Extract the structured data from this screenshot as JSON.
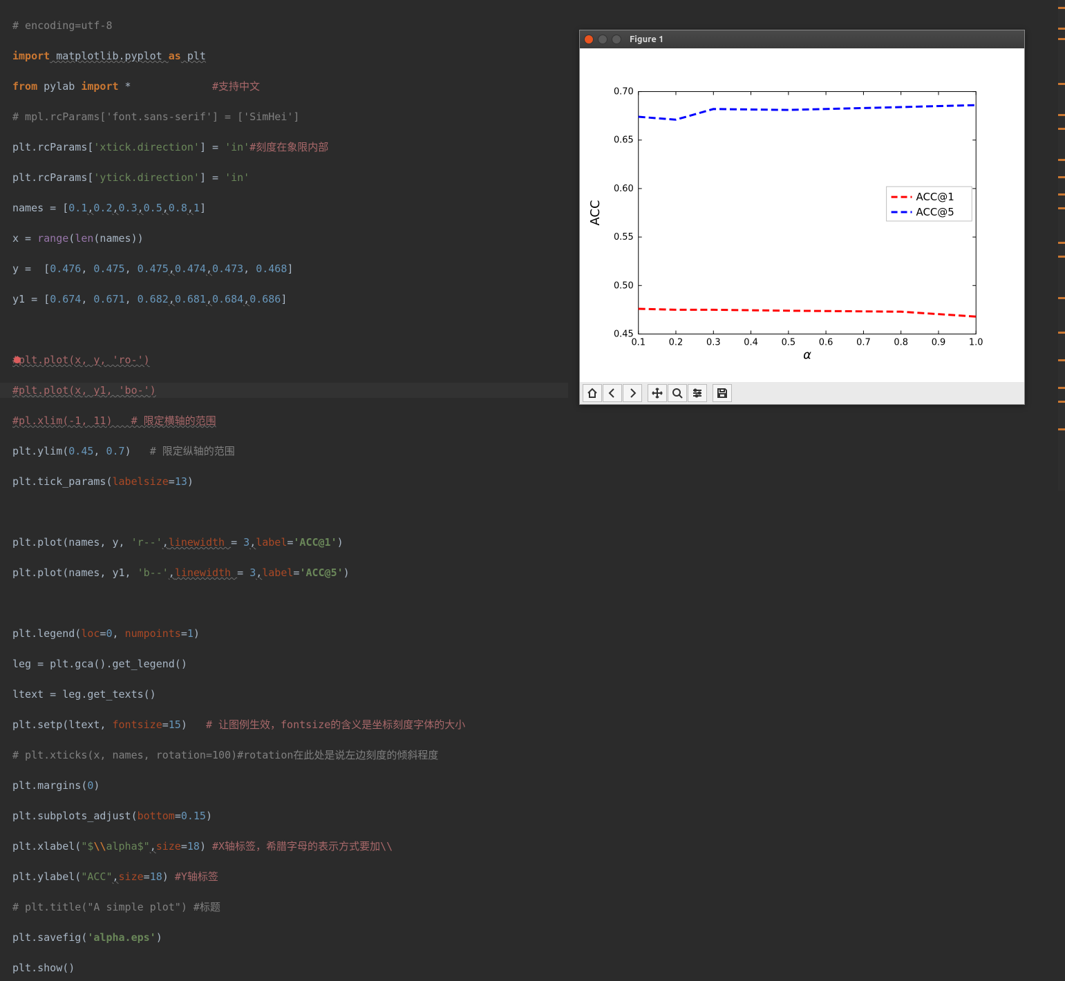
{
  "chart_data": {
    "type": "line",
    "x": [
      0.1,
      0.2,
      0.3,
      0.5,
      0.8,
      1.0
    ],
    "series": [
      {
        "name": "ACC@1",
        "values": [
          0.476,
          0.475,
          0.475,
          0.474,
          0.473,
          0.468
        ],
        "color": "#ff0000",
        "style": "dashed"
      },
      {
        "name": "ACC@5",
        "values": [
          0.674,
          0.671,
          0.682,
          0.681,
          0.684,
          0.686
        ],
        "color": "#0000ff",
        "style": "dashed"
      }
    ],
    "xlabel": "α",
    "ylabel": "ACC",
    "xlim": [
      0.1,
      1.0
    ],
    "ylim": [
      0.45,
      0.7
    ],
    "xticks": [
      0.1,
      0.2,
      0.3,
      0.4,
      0.5,
      0.6,
      0.7,
      0.8,
      0.9,
      1.0
    ],
    "yticks": [
      0.45,
      0.5,
      0.55,
      0.6,
      0.65,
      0.7
    ],
    "legend_position": "right"
  },
  "figure": {
    "title": "Figure 1"
  },
  "legend": {
    "item1": "ACC@1",
    "item2": "ACC@5"
  },
  "axis": {
    "xlabel": "α",
    "ylabel": "ACC"
  },
  "yt": {
    "t0": "0.45",
    "t1": "0.50",
    "t2": "0.55",
    "t3": "0.60",
    "t4": "0.65",
    "t5": "0.70"
  },
  "xt": {
    "t0": "0.1",
    "t1": "0.2",
    "t2": "0.3",
    "t3": "0.4",
    "t4": "0.5",
    "t5": "0.6",
    "t6": "0.7",
    "t7": "0.8",
    "t8": "0.9",
    "t9": "1.0"
  },
  "code": {
    "l1": "# encoding=utf-8",
    "l2a": "import",
    "l2b": " matplotlib.pyplot ",
    "l2c": "as",
    "l2d": " plt",
    "l3a": "from",
    "l3b": " pylab ",
    "l3c": "import",
    "l3d": " *",
    "l3e": "#支持中文",
    "l4": "# mpl.rcParams['font.sans-serif'] = ['SimHei']",
    "l5a": "plt.rcParams[",
    "l5b": "'xtick.direction'",
    "l5c": "] = ",
    "l5d": "'in'",
    "l5e": "#刻度在象限内部",
    "l6a": "plt.rcParams[",
    "l6b": "'ytick.direction'",
    "l6c": "] = ",
    "l6d": "'in'",
    "l7a": "names = [",
    "l7b": "0.1",
    "l7c": ",",
    "l7d": "0.2",
    "l7e": ",",
    "l7f": "0.3",
    "l7g": ",",
    "l7h": "0.5",
    "l7i": ",",
    "l7j": "0.8",
    "l7k": ",",
    "l7l": "1",
    "l7m": "]",
    "l8a": "x = ",
    "l8b": "range",
    "l8c": "(",
    "l8d": "len",
    "l8e": "(names))",
    "l9a": "y =  [",
    "l9b": "0.476",
    "l9c": ", ",
    "l9d": "0.475",
    "l9e": ", ",
    "l9f": "0.475",
    "l9g": ",",
    "l9h": "0.474",
    "l9i": ",",
    "l9j": "0.473",
    "l9k": ", ",
    "l9l": "0.468",
    "l9m": "]",
    "l10a": "y1 = [",
    "l10b": "0.674",
    "l10c": ", ",
    "l10d": "0.671",
    "l10e": ", ",
    "l10f": "0.682",
    "l10g": ",",
    "l10h": "0.681",
    "l10i": ",",
    "l10j": "0.684",
    "l10k": ",",
    "l10l": "0.686",
    "l10m": "]",
    "l12": "#plt.plot(x, y, 'ro-')",
    "l13": "#plt.plot(x, y1, 'bo-')",
    "l14": "#pl.xlim(-1, 11)   # 限定横轴的范围",
    "l15a": "plt.ylim(",
    "l15b": "0.45",
    "l15c": ", ",
    "l15d": "0.7",
    "l15e": ")   ",
    "l15f": "# 限定纵轴的范围",
    "l16a": "plt.tick_params(",
    "l16b": "labelsize",
    "l16c": "=",
    "l16d": "13",
    "l16e": ")",
    "l18a": "plt.plot(names, y, ",
    "l18b": "'r--'",
    "l18c": ",",
    "l18d": "linewidth ",
    "l18e": "= ",
    "l18f": "3",
    "l18g": ",",
    "l18h": "label",
    "l18i": "=",
    "l18j": "'ACC@1'",
    "l18k": ")",
    "l19a": "plt.plot(names, y1, ",
    "l19b": "'b--'",
    "l19c": ",",
    "l19d": "linewidth ",
    "l19e": "= ",
    "l19f": "3",
    "l19g": ",",
    "l19h": "label",
    "l19i": "=",
    "l19j": "'ACC@5'",
    "l19k": ")",
    "l21a": "plt.legend(",
    "l21b": "loc",
    "l21c": "=",
    "l21d": "0",
    "l21e": ", ",
    "l21f": "numpoints",
    "l21g": "=",
    "l21h": "1",
    "l21i": ")",
    "l22": "leg = plt.gca().get_legend()",
    "l23": "ltext = leg.get_texts()",
    "l24a": "plt.setp(ltext, ",
    "l24b": "fontsize",
    "l24c": "=",
    "l24d": "15",
    "l24e": ")   ",
    "l24f": "# 让图例生效，fontsize的含义是坐标刻度字体的大小",
    "l25": "# plt.xticks(x, names, rotation=100)#rotation在此处是说左边刻度的倾斜程度",
    "l26a": "plt.margins(",
    "l26b": "0",
    "l26c": ")",
    "l27a": "plt.subplots_adjust(",
    "l27b": "bottom",
    "l27c": "=",
    "l27d": "0.15",
    "l27e": ")",
    "l28a": "plt.xlabel(",
    "l28b": "\"$",
    "l28c": "\\\\",
    "l28d": "alpha$\"",
    "l28e": ",",
    "l28f": "size",
    "l28g": "=",
    "l28h": "18",
    "l28i": ") ",
    "l28j": "#X轴标签，希腊字母的表示方式要加\\\\",
    "l29a": "plt.ylabel(",
    "l29b": "\"ACC\"",
    "l29c": ",",
    "l29d": "size",
    "l29e": "=",
    "l29f": "18",
    "l29g": ") ",
    "l29h": "#Y轴标签",
    "l30": "# plt.title(\"A simple plot\") #标题",
    "l31a": "plt.savefig(",
    "l31b": "'alpha.eps'",
    "l31c": ")",
    "l32": "plt.show()"
  }
}
